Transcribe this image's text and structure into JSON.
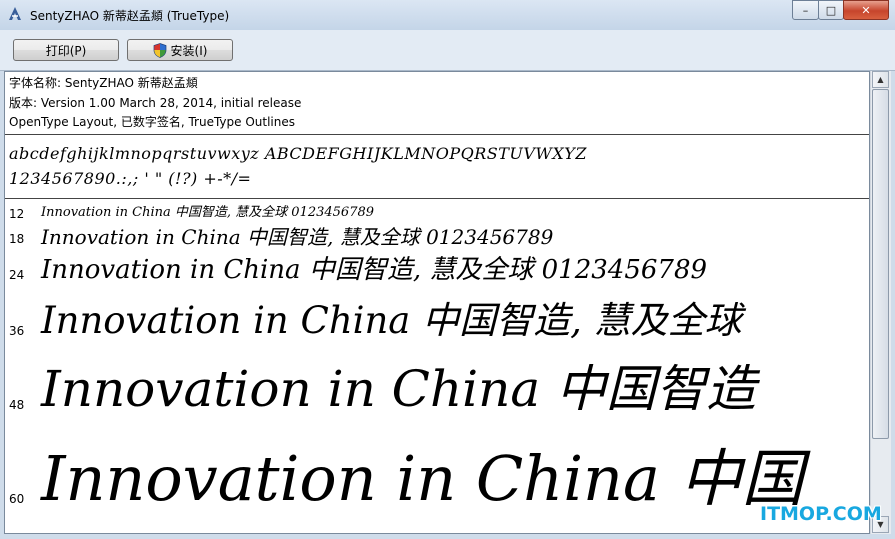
{
  "window": {
    "title": "SentyZHAO 新蒂赵孟頫 (TrueType)",
    "controls": {
      "minimize": "–",
      "maximize": "□",
      "close": "✕"
    }
  },
  "toolbar": {
    "print_label": "打印(P)",
    "install_label": "安装(I)"
  },
  "info": {
    "font_name": "字体名称: SentyZHAO 新蒂赵孟頫",
    "version": "版本: Version 1.00 March 28, 2014, initial release",
    "outline": "OpenType Layout, 已数字签名, TrueType Outlines"
  },
  "charset": {
    "letters": "abcdefghijklmnopqrstuvwxyz ABCDEFGHIJKLMNOPQRSTUVWXYZ",
    "digits": "1234567890.:,; ' \" (!?) +-*/="
  },
  "samples": [
    {
      "size": "12",
      "text": "Innovation in China 中国智造, 慧及全球 0123456789"
    },
    {
      "size": "18",
      "text": "Innovation in China 中国智造, 慧及全球 0123456789"
    },
    {
      "size": "24",
      "text": "Innovation in China 中国智造, 慧及全球 0123456789"
    },
    {
      "size": "36",
      "text": "Innovation in China 中国智造, 慧及全球"
    },
    {
      "size": "48",
      "text": "Innovation in China 中国智造"
    },
    {
      "size": "60",
      "text": "Innovation in China 中国"
    }
  ],
  "watermark": "ITMOP.COM",
  "icons": [
    "app-font-icon",
    "uac-shield-icon",
    "scroll-up-arrow-icon",
    "scroll-down-arrow-icon"
  ],
  "colors": {
    "watermark": "#18a8e0",
    "titlebar": "#c4d5e8",
    "close_button": "#c7452c"
  }
}
